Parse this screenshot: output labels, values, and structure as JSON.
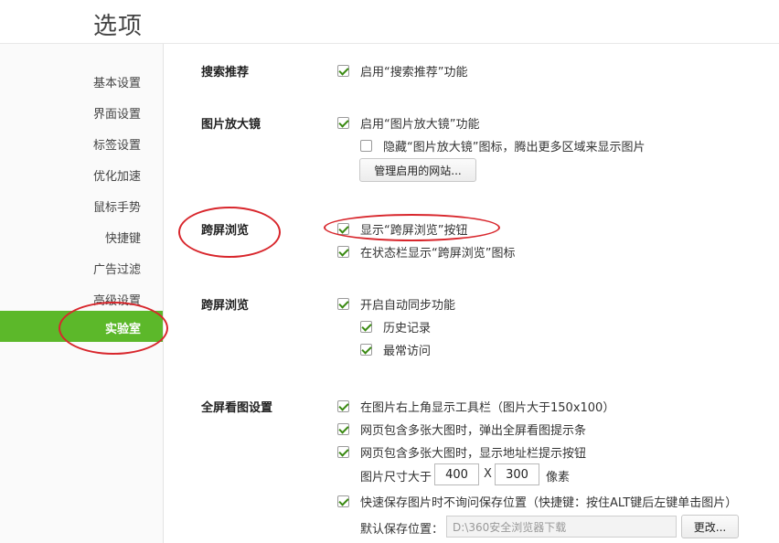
{
  "window": {
    "title": "选项"
  },
  "sidebar": {
    "items": [
      {
        "label": "基本设置"
      },
      {
        "label": "界面设置"
      },
      {
        "label": "标签设置"
      },
      {
        "label": "优化加速"
      },
      {
        "label": "鼠标手势"
      },
      {
        "label": "快捷键"
      },
      {
        "label": "广告过滤"
      },
      {
        "label": "高级设置"
      }
    ],
    "active": {
      "label": "实验室"
    },
    "active_color": "#5cb82a"
  },
  "sections": {
    "search": {
      "title": "搜索推荐",
      "enable": {
        "label": "启用“搜索推荐”功能",
        "checked": true
      }
    },
    "magnifier": {
      "title": "图片放大镜",
      "enable": {
        "label": "启用“图片放大镜”功能",
        "checked": true
      },
      "hide_icon": {
        "label": "隐藏“图片放大镜”图标，腾出更多区域来显示图片",
        "checked": false
      },
      "manage_button": "管理启用的网站..."
    },
    "cross_screen": {
      "title": "跨屏浏览",
      "show_button": {
        "label": "显示“跨屏浏览”按钮",
        "checked": true
      },
      "status_icon": {
        "label": "在状态栏显示“跨屏浏览”图标",
        "checked": true
      }
    },
    "sync": {
      "title": "跨屏浏览",
      "auto_sync": {
        "label": "开启自动同步功能",
        "checked": true
      },
      "history": {
        "label": "历史记录",
        "checked": true
      },
      "frequent": {
        "label": "最常访问",
        "checked": true
      }
    },
    "fullscreen": {
      "title": "全屏看图设置",
      "toolbar": {
        "label": "在图片右上角显示工具栏（图片大于150x100）",
        "checked": true
      },
      "popup": {
        "label": "网页包含多张大图时，弹出全屏看图提示条",
        "checked": true
      },
      "address_button": {
        "label": "网页包含多张大图时，显示地址栏提示按钮",
        "checked": true
      },
      "size_label": "图片尺寸大于",
      "width": "400",
      "x_sep": "X",
      "height": "300",
      "unit": "像素",
      "quick_save": {
        "label": "快速保存图片时不询问保存位置（快捷键：按住ALT键后左键单击图片）",
        "checked": true
      },
      "save_location_label": "默认保存位置：",
      "save_path": "D:\\360安全浏览器下载",
      "change_button": "更改..."
    }
  },
  "annotation_color": "#d8262c"
}
